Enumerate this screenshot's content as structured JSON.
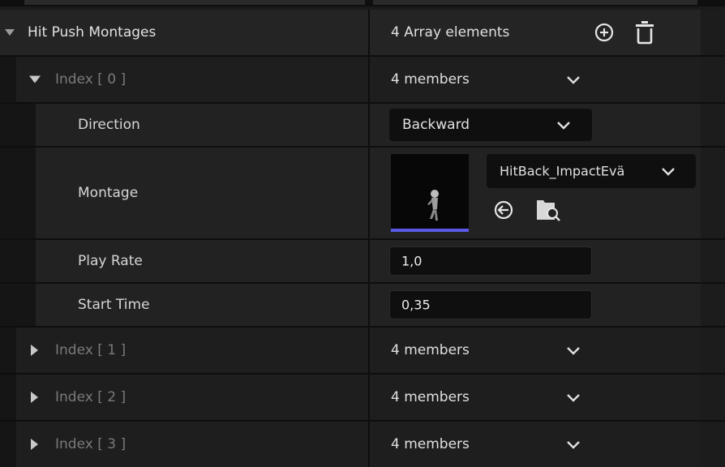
{
  "array": {
    "label": "Hit Push Montages",
    "count_text": "4 Array elements"
  },
  "index0": {
    "label": "Index [ 0 ]",
    "members_text": "4 members",
    "direction": {
      "label": "Direction",
      "value": "Backward"
    },
    "montage": {
      "label": "Montage",
      "asset_name": "HitBack_ImpactEvä"
    },
    "play_rate": {
      "label": "Play Rate",
      "value": "1,0"
    },
    "start_time": {
      "label": "Start Time",
      "value": "0,35"
    }
  },
  "indices": [
    {
      "label": "Index [ 1 ]",
      "members_text": "4 members"
    },
    {
      "label": "Index [ 2 ]",
      "members_text": "4 members"
    },
    {
      "label": "Index [ 3 ]",
      "members_text": "4 members"
    }
  ],
  "icons": {
    "add": "plus-circle-icon",
    "delete": "trash-icon",
    "browse_back": "arrow-left-circle-icon",
    "find_asset": "folder-search-icon"
  },
  "colors": {
    "accent_underline": "#5a5ae6"
  }
}
